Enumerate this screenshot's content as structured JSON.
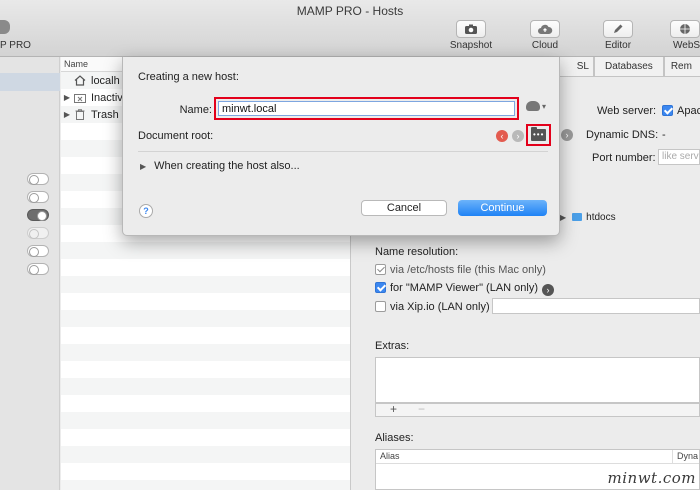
{
  "window": {
    "title": "MAMP PRO - Hosts"
  },
  "toolbar": {
    "left_partial_label": "P PRO",
    "buttons": [
      {
        "label": "Snapshot",
        "icon": "camera-icon"
      },
      {
        "label": "Cloud",
        "icon": "cloud-icon"
      },
      {
        "label": "Editor",
        "icon": "pen-icon"
      },
      {
        "label": "WebSt",
        "icon": "globe-icon"
      }
    ]
  },
  "hosts": {
    "column_header": "Name",
    "rows": [
      {
        "label": "localh",
        "icon": "house-icon",
        "expander": ""
      },
      {
        "label": "Inactiv",
        "icon": "folder-x-icon",
        "expander": "▶"
      },
      {
        "label": "Trash",
        "icon": "trash-icon",
        "expander": "▶"
      }
    ]
  },
  "right_panel": {
    "tabs": [
      "SL",
      "Databases",
      "Rem"
    ],
    "web_server_label": "Web server:",
    "web_server_value": "Apach",
    "dynamic_dns_label": "Dynamic DNS:",
    "dynamic_dns_value": "-",
    "port_number_label": "Port number:",
    "port_placeholder": "like serv",
    "doc_root_path": "htdocs",
    "name_resolution_label": "Name resolution:",
    "resolution_options": [
      {
        "label": "via /etc/hosts file (this Mac only)",
        "state": "gray"
      },
      {
        "label": "for \"MAMP Viewer\" (LAN only)",
        "state": "checked"
      },
      {
        "label": "via Xip.io (LAN only)",
        "state": "unchecked"
      }
    ],
    "extras_label": "Extras:",
    "add_symbol": "+",
    "remove_symbol": "−",
    "aliases_label": "Aliases:",
    "alias_column": "Alias",
    "alias_column_2": "Dyna"
  },
  "dialog": {
    "title": "Creating a new host:",
    "name_label": "Name:",
    "name_value": "minwt.local",
    "document_root_label": "Document root:",
    "expander_label": "When creating the host also...",
    "help_label": "?",
    "cancel_label": "Cancel",
    "continue_label": "Continue"
  },
  "watermark": "minwt.com",
  "colors": {
    "highlight": "#e3001b",
    "accent": "#1f82f5",
    "checked": "#3b87f0"
  }
}
